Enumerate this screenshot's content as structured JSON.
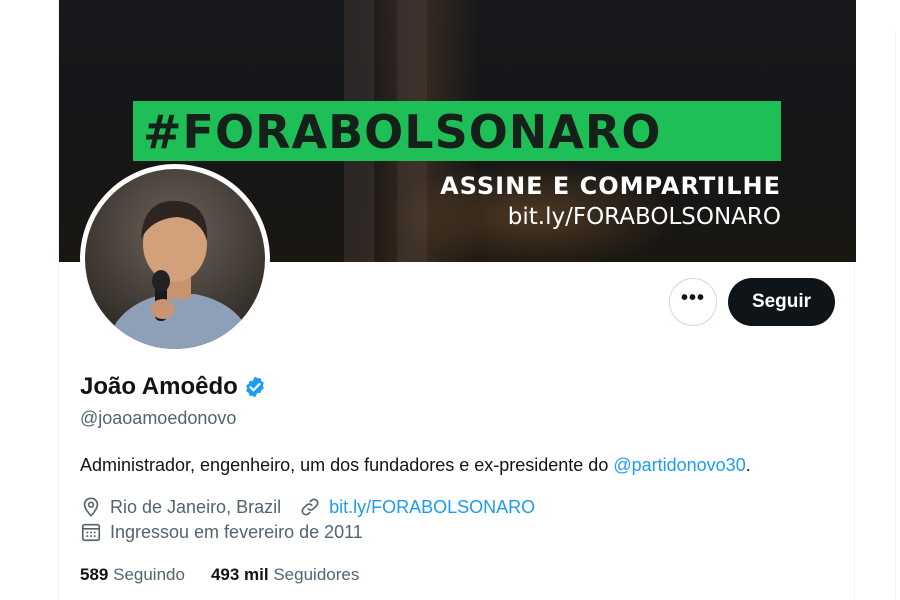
{
  "banner": {
    "hashtag": "#FORABOLSONARO",
    "headline": "ASSINE E COMPARTILHE",
    "link": "bit.ly/FORABOLSONARO",
    "accent_color": "#1fbf57"
  },
  "profile": {
    "display_name": "João Amoêdo",
    "verified_icon": "verified-badge-icon",
    "handle": "@joaoamoedonovo",
    "bio_text": "Administrador, engenheiro, um dos fundadores e ex-presidente do ",
    "bio_mention": "@partidonovo30",
    "bio_end": ".",
    "location": "Rio de Janeiro, Brazil",
    "website": "bit.ly/FORABOLSONARO",
    "joined": "Ingressou em fevereiro de 2011"
  },
  "actions": {
    "more_label": "•••",
    "follow_label": "Seguir"
  },
  "stats": {
    "following_count": "589",
    "following_label": "Seguindo",
    "followers_count": "493 mil",
    "followers_label": "Seguidores"
  },
  "colors": {
    "link": "#1d9bf0",
    "secondary_text": "#536471",
    "primary_text": "#0f1419",
    "button_dark": "#0f1419"
  }
}
